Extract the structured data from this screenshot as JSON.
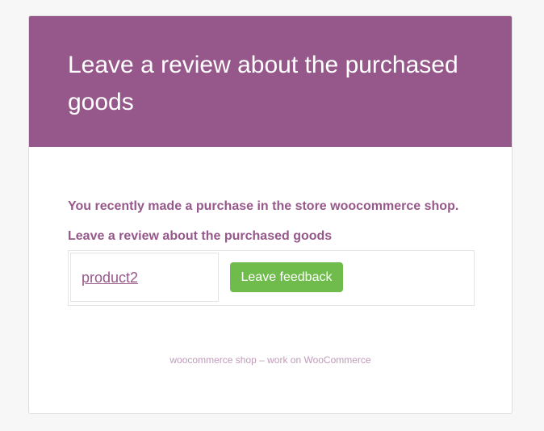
{
  "header": {
    "title": "Leave a review about the purchased goods"
  },
  "body": {
    "intro": "You recently made a purchase in the store woocommerce shop.",
    "subheading": "Leave a review about the purchased goods",
    "products": [
      {
        "name": "product2",
        "button_label": "Leave feedback"
      }
    ]
  },
  "footer": {
    "text": "woocommerce shop – work on WooCommerce"
  },
  "colors": {
    "brand": "#96588a",
    "button": "#6fbc4c",
    "background": "#f7f7f7"
  }
}
